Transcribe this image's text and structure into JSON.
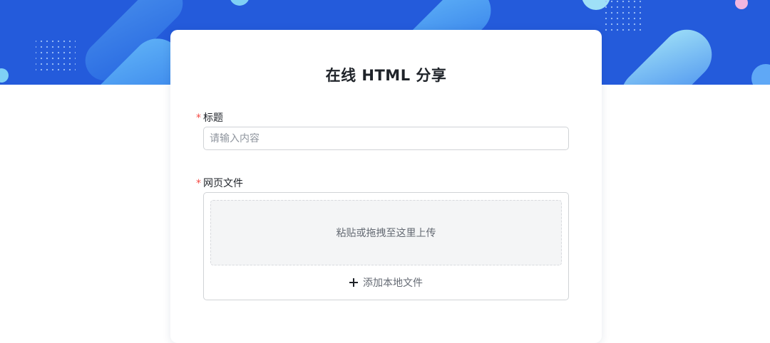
{
  "page": {
    "title": "在线 HTML 分享"
  },
  "form": {
    "required_mark": "*",
    "title_field": {
      "label": "标题",
      "placeholder": "请输入内容",
      "value": ""
    },
    "file_field": {
      "label": "网页文件",
      "dropzone_text": "粘贴或拖拽至这里上传",
      "add_local_label": "添加本地文件",
      "add_icon": "plus-icon"
    }
  },
  "colors": {
    "banner": "#245bdb",
    "required": "#f54a45",
    "text": "#1f2329",
    "muted_text": "#646a73"
  }
}
